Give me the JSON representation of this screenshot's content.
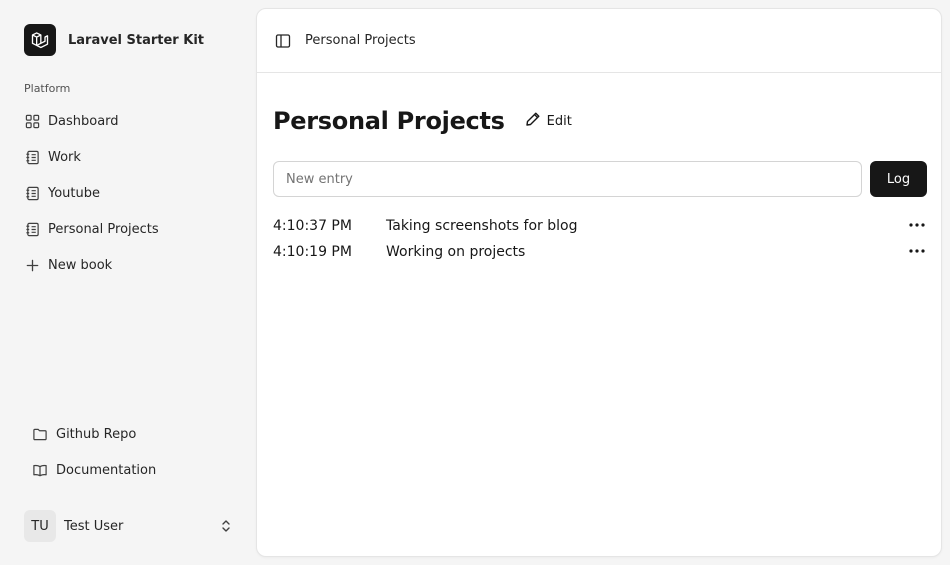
{
  "app": {
    "name": "Laravel Starter Kit"
  },
  "sidebar": {
    "section_label": "Platform",
    "items": [
      {
        "label": "Dashboard",
        "icon": "grid-icon"
      },
      {
        "label": "Work",
        "icon": "notebook-icon"
      },
      {
        "label": "Youtube",
        "icon": "notebook-icon"
      },
      {
        "label": "Personal Projects",
        "icon": "notebook-icon"
      },
      {
        "label": "New book",
        "icon": "plus-icon"
      }
    ],
    "footer_items": [
      {
        "label": "Github Repo",
        "icon": "folder-icon"
      },
      {
        "label": "Documentation",
        "icon": "book-open-icon"
      }
    ],
    "user": {
      "initials": "TU",
      "name": "Test User"
    }
  },
  "header": {
    "breadcrumb": "Personal Projects"
  },
  "main": {
    "title": "Personal Projects",
    "edit_label": "Edit",
    "entry_placeholder": "New entry",
    "entry_value": "",
    "log_label": "Log",
    "entries": [
      {
        "time": "4:10:37 PM",
        "text": "Taking screenshots for blog"
      },
      {
        "time": "4:10:19 PM",
        "text": "Working on projects"
      }
    ]
  },
  "colors": {
    "accent": "#171717",
    "sidebar_bg": "#f5f5f5",
    "panel_bg": "#ffffff",
    "border": "#e5e5e5"
  }
}
